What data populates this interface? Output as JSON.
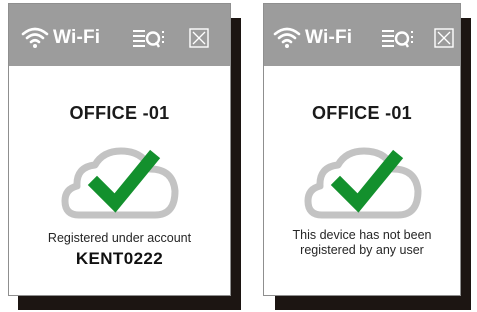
{
  "colors": {
    "titlebar": "#9c9c9c",
    "titlebar_text": "#ffffff",
    "checkmark": "#13902d",
    "cloud_outline": "#c3c3c3",
    "shadow": "#1c1512"
  },
  "icons": {
    "wifi": "wifi-icon",
    "list": "list-icon",
    "close": "close-icon",
    "cloud": "cloud-icon",
    "check": "checkmark-icon"
  },
  "panels": [
    {
      "title": "Wi-Fi",
      "device_name": "OFFICE -01",
      "status_line1": "Registered under account",
      "status_line2": "",
      "account": "KENT0222"
    },
    {
      "title": "Wi-Fi",
      "device_name": "OFFICE -01",
      "status_line1": "This device has not been",
      "status_line2": "registered by any user",
      "account": ""
    }
  ]
}
